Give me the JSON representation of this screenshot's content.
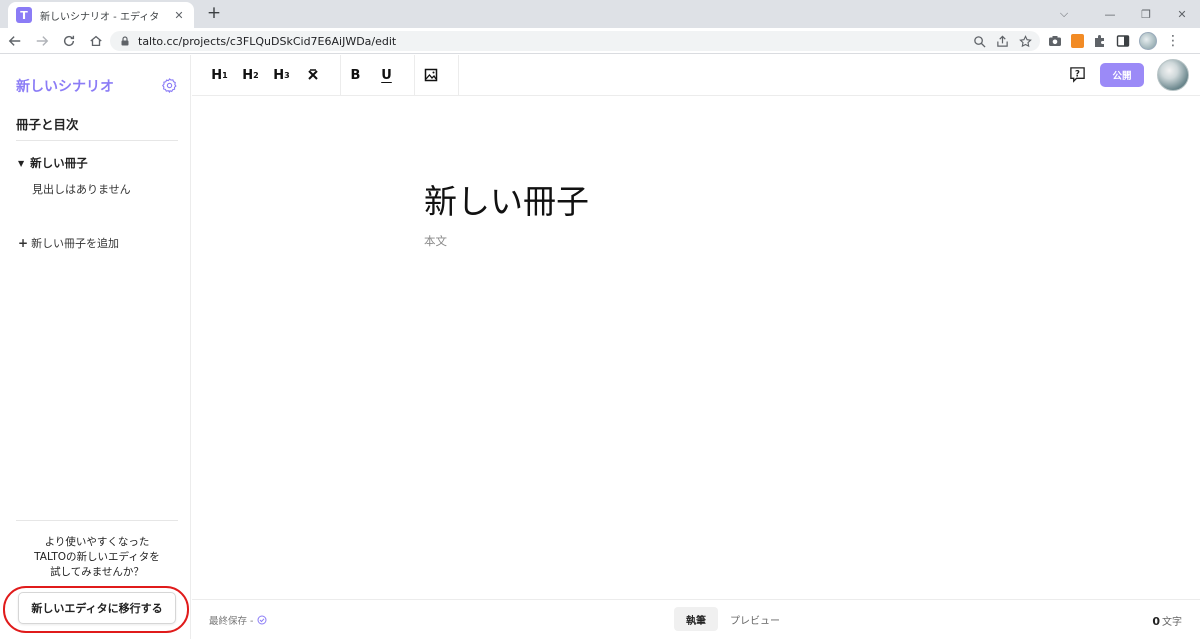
{
  "browser": {
    "tab_title": "新しいシナリオ - エディタ",
    "tab_favicon_letter": "T",
    "url": "talto.cc/projects/c3FLQuDSkCid7E6AiJWDa/edit"
  },
  "sidebar": {
    "scenario_title": "新しいシナリオ",
    "booklet_heading": "冊子と目次",
    "book_label": "新しい冊子",
    "no_headings": "見出しはありません",
    "add_book_label": "新しい冊子を追加",
    "promo_lines": [
      "より使いやすくなった",
      "TALTOの新しいエディタを",
      "試してみませんか？"
    ],
    "migrate_button": "新しいエディタに移行する"
  },
  "toolbar": {
    "h1": "H",
    "h1_sub": "1",
    "h2": "H",
    "h2_sub": "2",
    "h3": "H",
    "h3_sub": "3",
    "bold": "B",
    "underline": "U",
    "publish_label": "公開"
  },
  "document": {
    "title": "新しい冊子",
    "body_placeholder": "本文"
  },
  "status": {
    "last_saved": "最終保存 -",
    "tab_write": "執筆",
    "tab_preview": "プレビュー",
    "char_count": "0",
    "char_unit": "文字"
  },
  "colors": {
    "accent": "#8b7cf6",
    "publish": "#9b8af7",
    "annotation": "#e01b1b"
  }
}
